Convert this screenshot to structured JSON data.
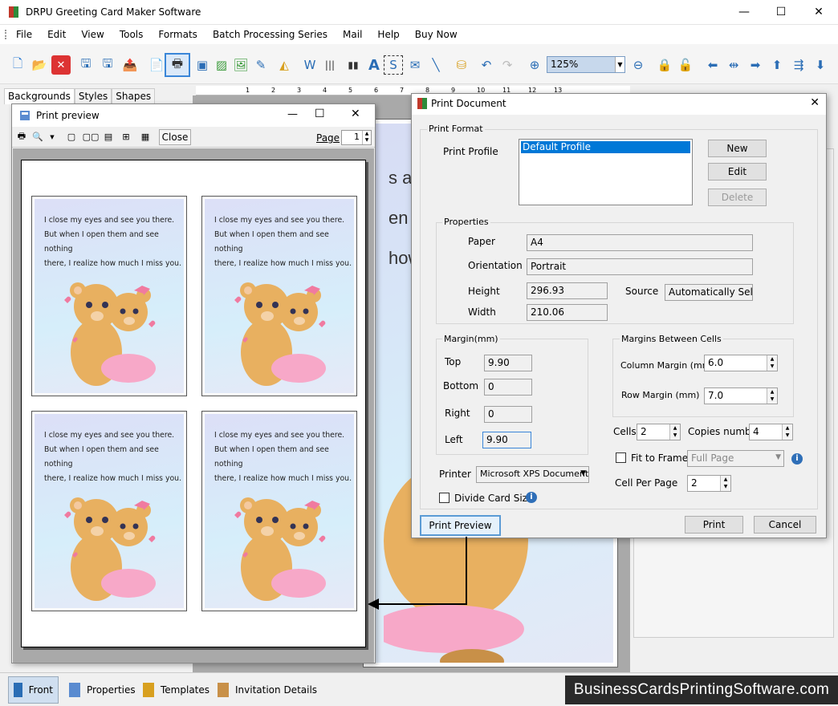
{
  "app": {
    "title": "DRPU Greeting Card Maker Software"
  },
  "menu": [
    "File",
    "Edit",
    "View",
    "Tools",
    "Formats",
    "Batch Processing Series",
    "Mail",
    "Help",
    "Buy Now"
  ],
  "toolbar": {
    "zoom": "125%"
  },
  "left_panel": {
    "tabs": [
      "Backgrounds",
      "Styles",
      "Shapes"
    ]
  },
  "ruler_marks": [
    "1",
    "2",
    "3",
    "4",
    "5",
    "6",
    "7",
    "8",
    "9",
    "10",
    "11",
    "12",
    "13"
  ],
  "canvas": {
    "text_lines": [
      "s and",
      "en th",
      "how"
    ]
  },
  "print_preview": {
    "title": "Print preview",
    "close_label": "Close",
    "page_label": "Page",
    "page_value": "1",
    "card_text": [
      "I close my eyes and see you there.",
      "But when I open them and see nothing",
      "there, I realize how much I miss you."
    ]
  },
  "print_document": {
    "title": "Print Document",
    "print_format_label": "Print Format",
    "print_profile_label": "Print Profile",
    "profile_selected": "Default Profile",
    "new_label": "New",
    "edit_label": "Edit",
    "delete_label": "Delete",
    "properties_label": "Properties",
    "paper_label": "Paper",
    "paper_value": "A4",
    "orientation_label": "Orientation",
    "orientation_value": "Portrait",
    "height_label": "Height",
    "height_value": "296.93",
    "width_label": "Width",
    "width_value": "210.06",
    "source_label": "Source",
    "source_value": "Automatically Select",
    "margin_label": "Margin(mm)",
    "top_label": "Top",
    "top_value": "9.90",
    "bottom_label": "Bottom",
    "bottom_value": "0",
    "right_label": "Right",
    "right_value": "0",
    "left_label": "Left",
    "left_value": "9.90",
    "mbc_label": "Margins Between Cells",
    "column_margin_label": "Column Margin (mm)",
    "column_margin_value": "6.0",
    "row_margin_label": "Row Margin (mm)",
    "row_margin_value": "7.0",
    "cells_label": "Cells",
    "cells_value": "2",
    "copies_label": "Copies number",
    "copies_value": "4",
    "fit_label": "Fit to Frame",
    "fit_value": "Full Page",
    "cell_per_page_label": "Cell Per Page",
    "cell_per_page_value": "2",
    "printer_label": "Printer",
    "printer_value": "Microsoft XPS Document Writer",
    "divide_label": "Divide Card Size",
    "preview_label": "Print Preview",
    "print_label": "Print",
    "cancel_label": "Cancel"
  },
  "bottom_tabs": [
    "Front",
    "Properties",
    "Templates",
    "Invitation Details"
  ],
  "watermark": "BusinessCardsPrintingSoftware.com"
}
